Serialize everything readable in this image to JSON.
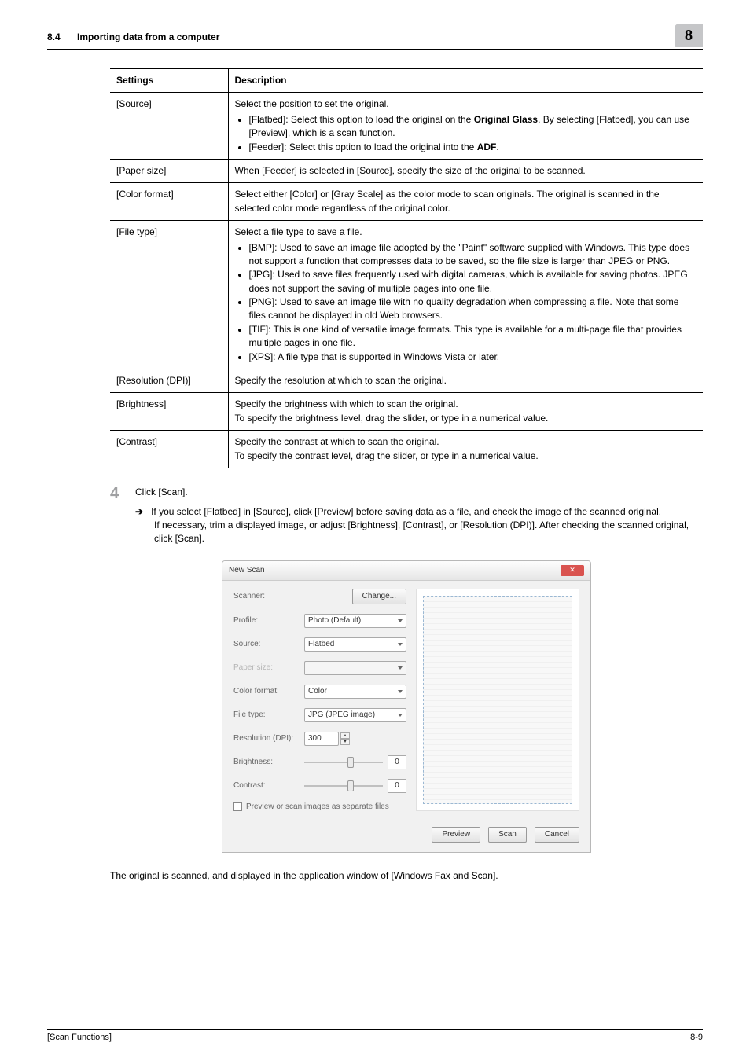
{
  "header": {
    "section_num": "8.4",
    "section_title": "Importing data from a computer",
    "chapter_tab": "8"
  },
  "table": {
    "head": {
      "settings": "Settings",
      "description": "Description"
    },
    "rows": [
      {
        "setting": "[Source]",
        "intro": "Select the position to set the original.",
        "bullets": [
          {
            "pre": "[Flatbed]: Select this option to load the original on the ",
            "bold": "Original Glass",
            "post": ". By selecting [Flatbed], you can use [Preview], which is a scan function."
          },
          {
            "pre": "[Feeder]: Select this option to load the original into the ",
            "bold": "ADF",
            "post": "."
          }
        ]
      },
      {
        "setting": "[Paper size]",
        "desc": "When [Feeder] is selected in [Source], specify the size of the original to be scanned."
      },
      {
        "setting": "[Color format]",
        "desc": "Select either [Color] or [Gray Scale] as the color mode to scan originals. The original is scanned in the selected color mode regardless of the original color."
      },
      {
        "setting": "[File type]",
        "intro": "Select a file type to save a file.",
        "bullets": [
          {
            "text": "[BMP]: Used to save an image file adopted by the \"Paint\" software supplied with Windows. This type does not support a function that compresses data to be saved, so the file size is larger than JPEG or PNG."
          },
          {
            "text": "[JPG]: Used to save files frequently used with digital cameras, which is available for saving photos. JPEG does not support the saving of multiple pages into one file."
          },
          {
            "text": "[PNG]: Used to save an image file with no quality degradation when compressing a file. Note that some files cannot be displayed in old Web browsers."
          },
          {
            "text": "[TIF]: This is one kind of versatile image formats. This type is available for a multi-page file that provides multiple pages in one file."
          },
          {
            "text": "[XPS]: A file type that is supported in Windows Vista or later."
          }
        ]
      },
      {
        "setting": "[Resolution (DPI)]",
        "desc": "Specify the resolution at which to scan the original."
      },
      {
        "setting": "[Brightness]",
        "desc": "Specify the brightness with which to scan the original.\nTo specify the brightness level, drag the slider, or type in a numerical value."
      },
      {
        "setting": "[Contrast]",
        "desc": "Specify the contrast at which to scan the original.\nTo specify the contrast level, drag the slider, or type in a numerical value."
      }
    ]
  },
  "step": {
    "num": "4",
    "text": "Click [Scan].",
    "arrow_text": "If you select [Flatbed] in [Source], click [Preview] before saving data as a file, and check the image of the scanned original.",
    "after": "If necessary, trim a displayed image, or adjust [Brightness], [Contrast], or [Resolution (DPI)]. After checking the scanned original, click [Scan]."
  },
  "dialog": {
    "title": "New Scan",
    "scanner_label": "Scanner:",
    "change_button": "Change...",
    "profile": {
      "label": "Profile:",
      "value": "Photo (Default)"
    },
    "source": {
      "label": "Source:",
      "value": "Flatbed"
    },
    "paper_size": {
      "label": "Paper size:",
      "value": ""
    },
    "color_format": {
      "label": "Color format:",
      "value": "Color"
    },
    "file_type": {
      "label": "File type:",
      "value": "JPG (JPEG image)"
    },
    "resolution": {
      "label": "Resolution (DPI):",
      "value": "300"
    },
    "brightness": {
      "label": "Brightness:",
      "value": "0"
    },
    "contrast": {
      "label": "Contrast:",
      "value": "0"
    },
    "checkbox": "Preview or scan images as separate files",
    "buttons": {
      "preview": "Preview",
      "scan": "Scan",
      "cancel": "Cancel"
    }
  },
  "outro": "The original is scanned, and displayed in the application window of [Windows Fax and Scan].",
  "footer": {
    "left": "[Scan Functions]",
    "right": "8-9"
  }
}
